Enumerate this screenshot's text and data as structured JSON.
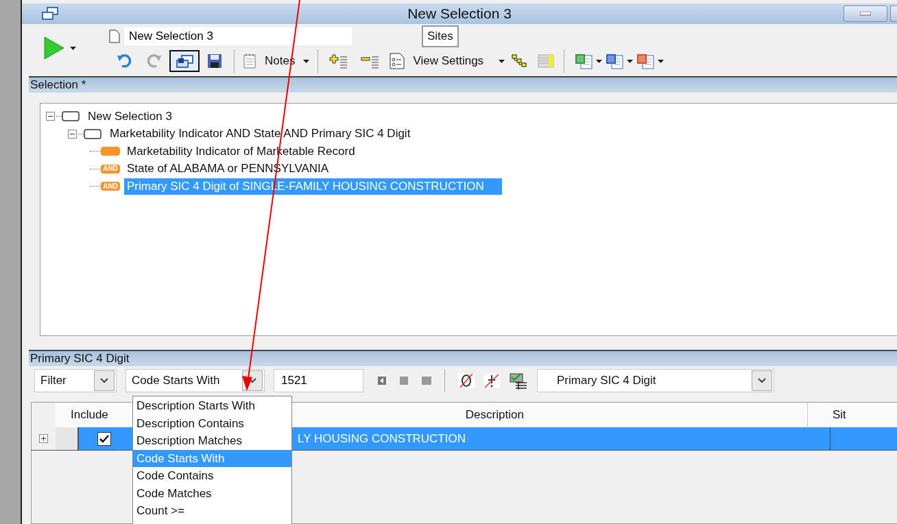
{
  "window": {
    "title": "New Selection 3"
  },
  "toolbar": {
    "selection_name": "New Selection 3",
    "sites": "Sites",
    "notes": "Notes",
    "view_settings": "View Settings",
    "lock_selected": true
  },
  "selection_panel": {
    "title": "Selection *",
    "tree": [
      {
        "kind": "group",
        "label": "New Selection 3",
        "expanded": true,
        "selected": false,
        "children": [
          {
            "kind": "group",
            "label": "Marketability Indicator AND State AND Primary SIC 4 Digit",
            "expanded": true,
            "selected": false,
            "children": [
              {
                "kind": "condition",
                "label": "Marketability Indicator of Marketable Record",
                "selected": false
              },
              {
                "kind": "condition",
                "badge": "AND",
                "label": "State of ALABAMA or PENNSYLVANIA",
                "selected": false
              },
              {
                "kind": "condition",
                "badge": "AND",
                "label": "Primary SIC 4 Digit of SINGLE-FAMILY HOUSING CONSTRUCTION",
                "selected": true
              }
            ]
          }
        ]
      }
    ]
  },
  "filter_panel": {
    "title": "Primary SIC 4 Digit",
    "mode": "Filter",
    "operator": "Code Starts With",
    "value": "1521",
    "field": "Primary SIC 4 Digit",
    "operator_options": [
      {
        "label": "Description Starts With",
        "selected": false
      },
      {
        "label": "Description Contains",
        "selected": false
      },
      {
        "label": "Description Matches",
        "selected": false
      },
      {
        "label": "Code Starts With",
        "selected": true
      },
      {
        "label": "Code Contains",
        "selected": false
      },
      {
        "label": "Code Matches",
        "selected": false
      },
      {
        "label": "Count >=",
        "selected": false
      }
    ],
    "grid": {
      "columns": [
        "Include",
        "Description",
        "Sit"
      ],
      "rows": [
        {
          "expanded": false,
          "checked": true,
          "selected": true,
          "description": "LY HOUSING CONSTRUCTION"
        }
      ]
    }
  }
}
